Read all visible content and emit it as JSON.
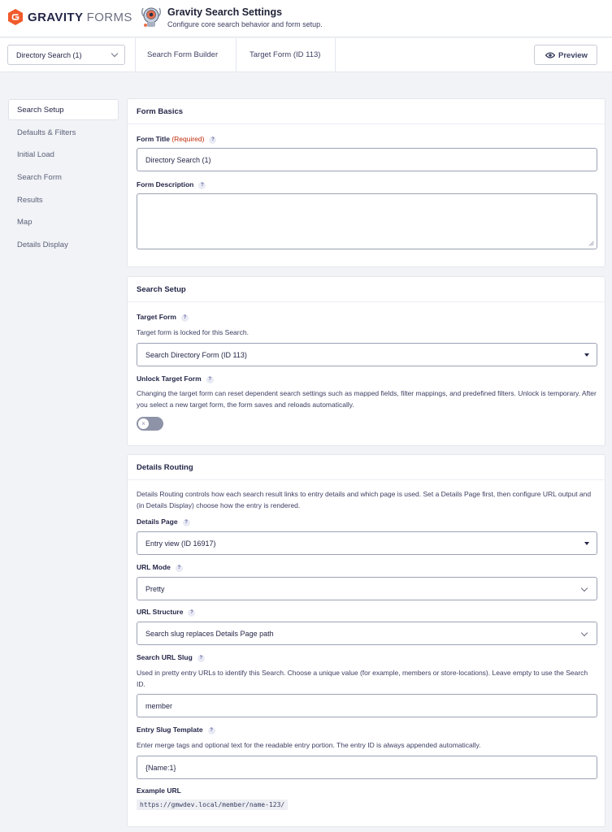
{
  "header": {
    "brand_bold": "GRAVITY",
    "brand_light": "FORMS",
    "title": "Gravity Search Settings",
    "subtitle": "Configure core search behavior and form setup.",
    "brand_color": "#f15a2b"
  },
  "toolbar": {
    "search_selector": "Directory Search (1)",
    "tabs": [
      "Search Form Builder",
      "Target Form (ID 113)"
    ],
    "preview_label": "Preview"
  },
  "sidebar": {
    "items": [
      {
        "label": "Search Setup",
        "active": true
      },
      {
        "label": "Defaults & Filters"
      },
      {
        "label": "Initial Load"
      },
      {
        "label": "Search Form"
      },
      {
        "label": "Results"
      },
      {
        "label": "Map"
      },
      {
        "label": "Details Display"
      }
    ]
  },
  "form_basics": {
    "title": "Form Basics",
    "form_title_label": "Form Title",
    "required_text": "(Required)",
    "form_title_value": "Directory Search (1)",
    "form_description_label": "Form Description",
    "form_description_value": ""
  },
  "search_setup": {
    "title": "Search Setup",
    "target_form_label": "Target Form",
    "target_form_note": "Target form is locked for this Search.",
    "target_form_value": "Search Directory Form (ID 113)",
    "unlock_label": "Unlock Target Form",
    "unlock_desc": "Changing the target form can reset dependent search settings such as mapped fields, filter mappings, and predefined filters. Unlock is temporary. After you select a new target form, the form saves and reloads automatically.",
    "unlock_enabled": false
  },
  "details_routing": {
    "title": "Details Routing",
    "intro": "Details Routing controls how each search result links to entry details and which page is used. Set a Details Page first, then configure URL output and (in Details Display) choose how the entry is rendered.",
    "details_page_label": "Details Page",
    "details_page_value": "Entry view (ID 16917)",
    "url_mode_label": "URL Mode",
    "url_mode_value": "Pretty",
    "url_structure_label": "URL Structure",
    "url_structure_value": "Search slug replaces Details Page path",
    "slug_label": "Search URL Slug",
    "slug_desc": "Used in pretty entry URLs to identify this Search. Choose a unique value (for example, members or store-locations). Leave empty to use the Search ID.",
    "slug_value": "member",
    "entry_slug_label": "Entry Slug Template",
    "entry_slug_desc": "Enter merge tags and optional text for the readable entry portion. The entry ID is always appended automatically.",
    "entry_slug_value": "{Name:1}",
    "example_url_label": "Example URL",
    "example_url": "https://gmwdev.local/member/name-123/"
  },
  "help_glyph": "?"
}
